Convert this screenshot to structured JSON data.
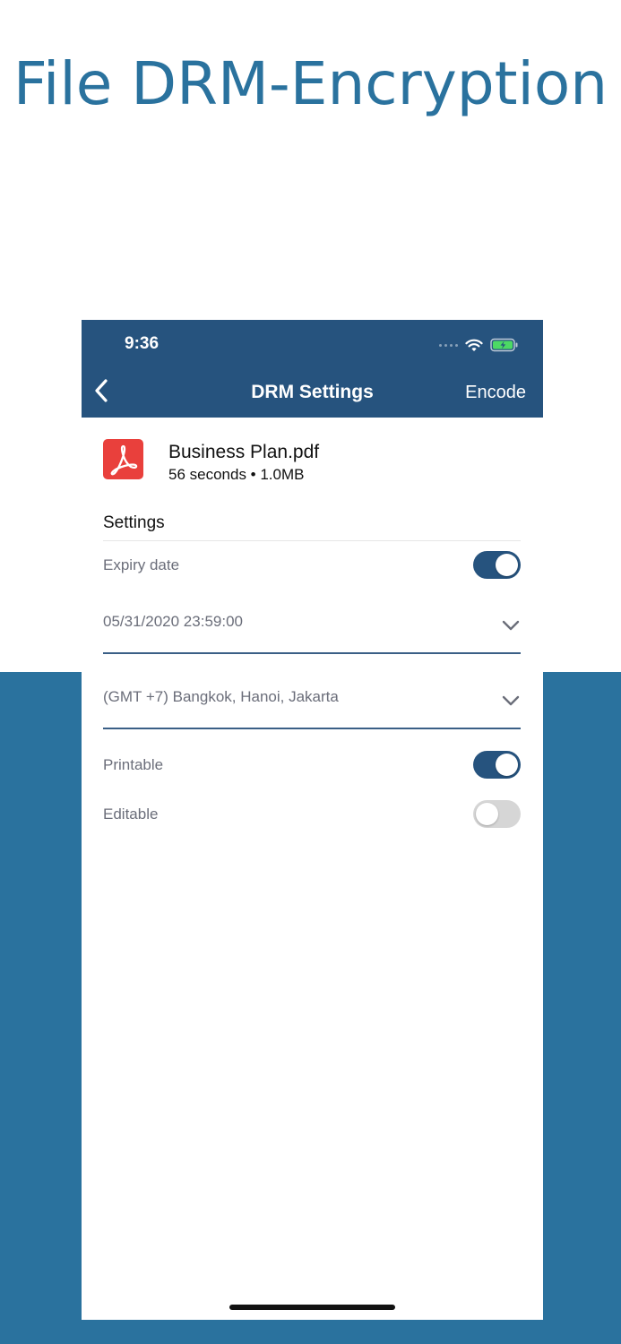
{
  "hero": {
    "title": "File DRM-Encryption"
  },
  "status_bar": {
    "time": "9:36",
    "icons": [
      "signal-dots",
      "wifi-icon",
      "battery-charging-icon"
    ]
  },
  "nav": {
    "title": "DRM Settings",
    "action_label": "Encode",
    "back_icon": "chevron-left-icon"
  },
  "file": {
    "name": "Business Plan.pdf",
    "meta": "56 seconds • 1.0MB",
    "icon": "pdf-icon"
  },
  "settings": {
    "section_title": "Settings",
    "expiry": {
      "label": "Expiry date",
      "enabled": true
    },
    "expiry_date_value": "05/31/2020 23:59:00",
    "timezone_value": "(GMT +7) Bangkok, Hanoi, Jakarta",
    "printable": {
      "label": "Printable",
      "enabled": true
    },
    "editable": {
      "label": "Editable",
      "enabled": false
    }
  },
  "colors": {
    "brand_blue": "#2a729e",
    "nav_blue": "#26537e",
    "pdf_red": "#e9403c",
    "toggle_off": "#d6d6d6"
  }
}
